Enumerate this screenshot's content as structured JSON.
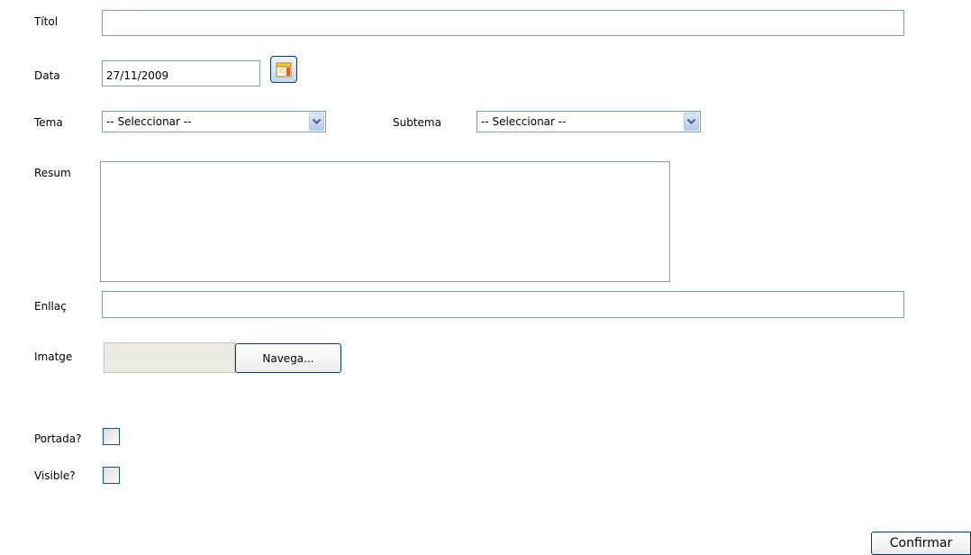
{
  "form": {
    "titol": {
      "label": "Títol",
      "value": ""
    },
    "data": {
      "label": "Data",
      "value": "27/11/2009"
    },
    "tema": {
      "label": "Tema",
      "selected": "-- Seleccionar --"
    },
    "subtema": {
      "label": "Subtema",
      "selected": "-- Seleccionar --"
    },
    "resum": {
      "label": "Resum",
      "value": ""
    },
    "enllac": {
      "label": "Enllaç",
      "value": ""
    },
    "imatge": {
      "label": "Imatge",
      "value": "",
      "browse_label": "Navega..."
    },
    "portada": {
      "label": "Portada?",
      "checked": false
    },
    "visible": {
      "label": "Visible?",
      "checked": false
    },
    "confirm_label": "Confirmar"
  },
  "icons": {
    "calendar": "calendar-icon",
    "dropdown": "chevron-down-icon"
  },
  "colors": {
    "input_border": "#7f9db9",
    "button_border": "#003c74",
    "dropdown_arrow": "#4d6185"
  }
}
